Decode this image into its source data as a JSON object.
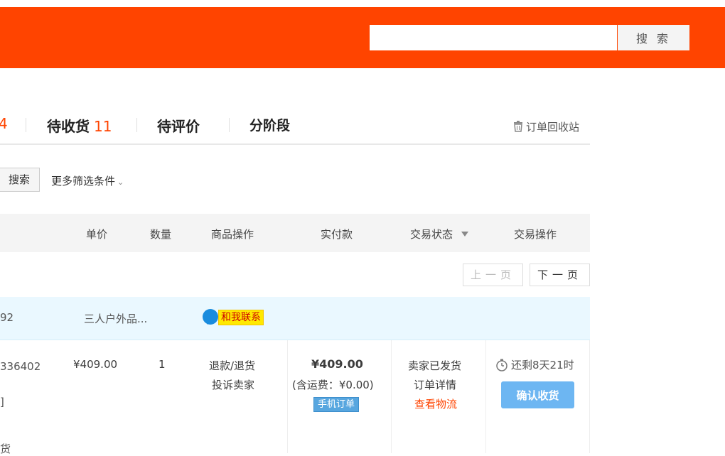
{
  "header": {
    "search_placeholder": "",
    "search_button": "搜 索",
    "brand_color": "#ff4400"
  },
  "tabs": [
    {
      "label": "",
      "count": "4"
    },
    {
      "label": "待收货",
      "count": "11"
    },
    {
      "label": "待评价",
      "count": ""
    },
    {
      "label": "分阶段",
      "count": ""
    }
  ],
  "recycle_bin": {
    "icon": "trash-icon",
    "label": "订单回收站"
  },
  "filters": {
    "search_button": "搜索",
    "more_filters": "更多筛选条件",
    "chevron": "⌄"
  },
  "table_headers": [
    "单价",
    "数量",
    "商品操作",
    "实付款",
    "交易状态",
    "交易操作"
  ],
  "pagination": {
    "prev": "上一页",
    "next": "下一页"
  },
  "order": {
    "number_fragment": "92",
    "shop_name": "三人户外品...",
    "contact_label": "和我联系",
    "item_id_fragment": "336402",
    "left_fragment_1": "]",
    "left_fragment_2": "货",
    "unit_price": "¥409.00",
    "quantity": "1",
    "actions": [
      "退款/退货",
      "投诉卖家"
    ],
    "total": "¥409.00",
    "shipping_note": "(含运费：¥0.00)",
    "mobile_tag": "手机订单",
    "status": [
      "卖家已发货",
      "订单详情"
    ],
    "logistics_link": "查看物流",
    "countdown": "还剩8天21时",
    "confirm_button": "确认收货"
  }
}
